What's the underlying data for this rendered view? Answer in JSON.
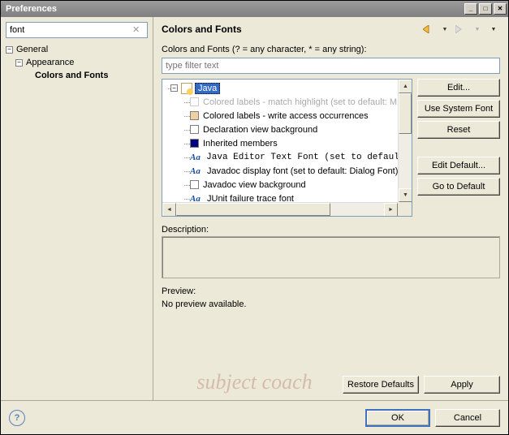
{
  "window": {
    "title": "Preferences"
  },
  "left": {
    "filter_value": "font",
    "tree": {
      "root": "General",
      "child": "Appearance",
      "leaf": "Colors and Fonts"
    }
  },
  "right": {
    "title": "Colors and Fonts",
    "filter_label": "Colors and Fonts (? = any character, * = any string):",
    "filter_placeholder": "type filter text",
    "tree": {
      "root": "Java",
      "items": [
        {
          "label": "Colored labels - match highlight (set to default: M",
          "swatch": "disabled",
          "disabled": true
        },
        {
          "label": "Colored labels - write access occurrences",
          "swatch": "tan"
        },
        {
          "label": "Declaration view background",
          "swatch": "white"
        },
        {
          "label": "Inherited members",
          "swatch": "navy"
        },
        {
          "label": "Java Editor Text Font (set to default:  ",
          "icon": "aa",
          "mono": true
        },
        {
          "label": "Javadoc display font (set to default: Dialog Font)",
          "icon": "aa"
        },
        {
          "label": "Javadoc view background",
          "swatch": "white"
        },
        {
          "label": "JUnit failure trace font",
          "icon": "aa"
        }
      ]
    },
    "buttons": {
      "edit": "Edit...",
      "use_system_font": "Use System Font",
      "reset": "Reset",
      "edit_default": "Edit Default...",
      "go_to_default": "Go to Default"
    },
    "description_label": "Description:",
    "preview_label": "Preview:",
    "preview_value": "No preview available.",
    "restore_defaults": "Restore Defaults",
    "apply": "Apply"
  },
  "footer": {
    "ok": "OK",
    "cancel": "Cancel"
  },
  "watermark": "subject coach"
}
